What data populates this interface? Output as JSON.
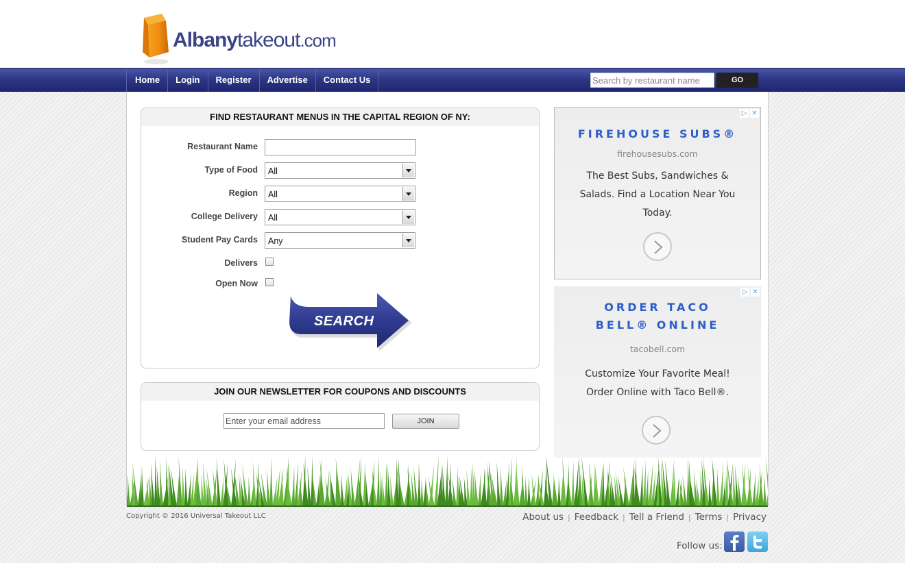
{
  "brand": {
    "part1": "Albany",
    "part2": "takeout",
    "part3": ".com"
  },
  "nav": {
    "items": [
      {
        "label": "Home"
      },
      {
        "label": "Login"
      },
      {
        "label": "Register"
      },
      {
        "label": "Advertise"
      },
      {
        "label": "Contact Us"
      }
    ],
    "search_placeholder": "Search by restaurant name",
    "go_label": "GO"
  },
  "find": {
    "title": "FIND RESTAURANT MENUS IN THE CAPITAL REGION OF NY:",
    "fields": {
      "restaurant_name": {
        "label": "Restaurant Name",
        "value": ""
      },
      "type_of_food": {
        "label": "Type of Food",
        "value": "All"
      },
      "region": {
        "label": "Region",
        "value": "All"
      },
      "college_delivery": {
        "label": "College Delivery",
        "value": "All"
      },
      "student_pay_cards": {
        "label": "Student Pay Cards",
        "value": "Any"
      },
      "delivers": {
        "label": "Delivers",
        "checked": false
      },
      "open_now": {
        "label": "Open Now",
        "checked": false
      }
    },
    "search_label": "SEARCH"
  },
  "newsletter": {
    "title": "JOIN OUR NEWSLETTER FOR COUPONS AND DISCOUNTS",
    "email_placeholder": "Enter your email address",
    "join_label": "JOIN"
  },
  "ads": [
    {
      "title_lines": [
        "FIREHOUSE SUBS®"
      ],
      "url": "firehousesubs.com",
      "body_lines": [
        "The Best Subs, Sandwiches &",
        "Salads. Find a Location Near You",
        "Today."
      ]
    },
    {
      "title_lines": [
        "ORDER TACO",
        "BELL® ONLINE"
      ],
      "url": "tacobell.com",
      "body_lines": [
        "Customize Your Favorite Meal!",
        "Order Online with Taco Bell®."
      ]
    }
  ],
  "footer": {
    "copyright": "Copyright © 2016 Universal Takeout LLC",
    "links": [
      "About us",
      "Feedback",
      "Tell a Friend",
      "Terms",
      "Privacy"
    ],
    "follow_label": "Follow us:"
  },
  "colors": {
    "nav_blue": "#2d3785",
    "brand_blue": "#3a4388",
    "ad_title_blue": "#2c5ec9",
    "grass_green": "#4f9a2a"
  }
}
